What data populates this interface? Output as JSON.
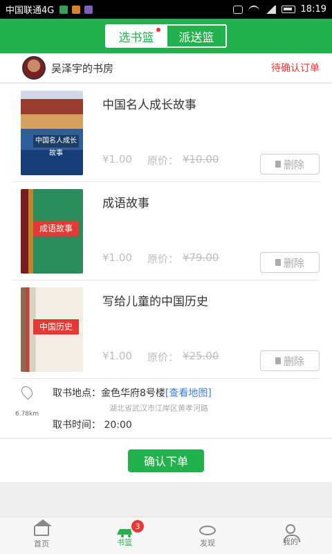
{
  "status_bar": {
    "carrier": "中国联通4G",
    "time": "18:19"
  },
  "header": {
    "tabs": [
      {
        "label": "选书篮",
        "active": true
      },
      {
        "label": "派送篮",
        "active": false
      }
    ]
  },
  "shop": {
    "name": "吴泽宇的书房",
    "pending_link": "待确认订单"
  },
  "books": [
    {
      "title": "中国名人成长故事",
      "price": "¥1.00",
      "orig_label": "原价：",
      "orig_price": "¥10.00",
      "delete_label": "删除",
      "cover_text": "中国名人成长故事"
    },
    {
      "title": "成语故事",
      "price": "¥1.00",
      "orig_label": "原价：",
      "orig_price": "¥79.00",
      "delete_label": "删除",
      "cover_text": "成语故事"
    },
    {
      "title": "写给儿童的中国历史",
      "price": "¥1.00",
      "orig_label": "原价：",
      "orig_price": "¥25.00",
      "delete_label": "删除",
      "cover_text": "中国历史"
    }
  ],
  "pickup": {
    "distance": "6.78km",
    "location_label": "取书地点：",
    "location_value": "金色华府8号楼",
    "map_link": "[查看地图]",
    "address_sub": "湖北省武汉市江岸区黄孝河路",
    "time_label": "取书时间：",
    "time_value": "20:00"
  },
  "confirm_label": "确认下单",
  "bottom_nav": [
    {
      "label": "首页",
      "icon": "home-icon",
      "active": false
    },
    {
      "label": "书篮",
      "icon": "cart-icon",
      "active": true,
      "badge": "3"
    },
    {
      "label": "发现",
      "icon": "eye-icon",
      "active": false
    },
    {
      "label": "我的",
      "icon": "user-icon",
      "active": false
    }
  ],
  "colors": {
    "primary": "#22b14c",
    "danger": "#e53935",
    "link": "#3f7fd6"
  }
}
